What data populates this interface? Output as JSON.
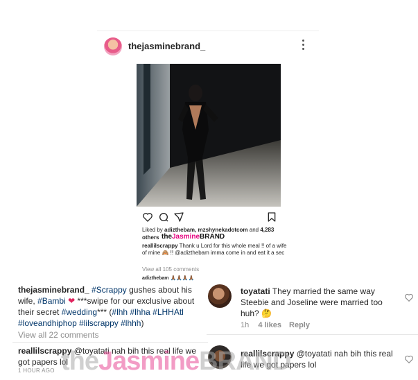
{
  "post": {
    "username": "thejasminebrand_",
    "likes_prefix": "Liked by",
    "likes_users": "adizthebam, mzshynekadotcom",
    "likes_and": "and",
    "likes_count": "4,283",
    "likes_others": "others",
    "inner_caption_user": "reallilscrappy",
    "inner_caption_text": "Thank u Lord for this whole meal !! of a wife of mine 🙈 !! @adizthebam imma come in and eat it a sec",
    "view_all_small": "View all 105 comments",
    "commenter_small": "adizthebam 🙏🏾🙏🏾🙏🏾🙏🏾"
  },
  "watermark": {
    "prefix": "the",
    "brand": "Jasmine",
    "suffix": "BRAND"
  },
  "caption": {
    "user": "thejasminebrand_",
    "tag_scrappy": "#Scrappy",
    "text_1": "gushes about his wife,",
    "tag_bambi": "#Bambi",
    "heart": "❤",
    "text_2": "***swipe for our exclusive about their secret",
    "tag_wedding": "#wedding",
    "text_3": "*** (",
    "tags_line": "#lhh #lhha #LHHAtl",
    "tags_line_2": "#loveandhiphop #lilscrappy #lhhh",
    "text_close": ")",
    "view_all": "View all 22 comments"
  },
  "left_reply": {
    "user": "reallilscrappy",
    "text": "@toyatati nah bih this real life we got papers lol",
    "time": "1 HOUR AGO"
  },
  "comments": [
    {
      "user": "toyatati",
      "text": "They married the same way Steebie and Joseline were married too huh? 🤔",
      "time": "1h",
      "likes": "4 likes",
      "reply": "Reply"
    },
    {
      "user": "reallilscrappy",
      "text": "@toyatati nah bih this real life we got papers lol"
    }
  ],
  "icons": {
    "more": "more-options-icon",
    "like": "heart-icon",
    "comment": "comment-icon",
    "share": "share-icon",
    "bookmark": "bookmark-icon"
  },
  "colors": {
    "brand_pink": "#e6007e",
    "muted": "#8e8e8e",
    "heart_red": "#e0245e"
  }
}
